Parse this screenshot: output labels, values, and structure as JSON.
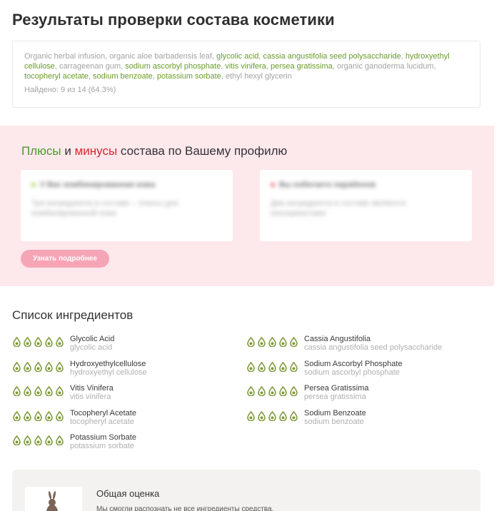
{
  "page": {
    "title": "Результаты проверки состава косметики"
  },
  "composition": {
    "items": [
      {
        "text": "Organic herbal infusion",
        "recognized": false
      },
      {
        "text": "organic aloe barbadensis leaf",
        "recognized": false
      },
      {
        "text": "glycolic acid",
        "recognized": true
      },
      {
        "text": "cassia angustifolia seed polysaccharide",
        "recognized": true
      },
      {
        "text": "hydroxyethyl cellulose",
        "recognized": true
      },
      {
        "text": "carrageenan gum",
        "recognized": false
      },
      {
        "text": "sodium ascorbyl phosphate",
        "recognized": true
      },
      {
        "text": "vitis vinifera",
        "recognized": true
      },
      {
        "text": "persea gratissima",
        "recognized": true
      },
      {
        "text": "organic ganoderma lucidum",
        "recognized": false
      },
      {
        "text": "tocopheryl acetate",
        "recognized": true
      },
      {
        "text": "sodium benzoate",
        "recognized": true
      },
      {
        "text": "potassium sorbate",
        "recognized": true
      },
      {
        "text": "ethyl hexyl glycerin",
        "recognized": false
      }
    ],
    "found_text": "Найдено: 9 из 14 (64.3%)"
  },
  "pros_cons": {
    "title_plus": "Плюсы",
    "title_and": " и ",
    "title_minus": "минусы",
    "title_rest": " состава по Вашему профилю",
    "left_card": {
      "heading": "У Вас комбинированная кожа",
      "body": "Три ингредиента в составе – плюсы для комбинированной кожи"
    },
    "right_card": {
      "heading": "Вы избегаете парабенов",
      "body": "Два ингредиента в составе являются консервантами"
    },
    "more_button": "Узнать подробнее"
  },
  "ingredients": {
    "title": "Список ингредиентов",
    "items": [
      {
        "name": "Glycolic Acid",
        "sub": "glycolic acid",
        "rating": 5
      },
      {
        "name": "Cassia Angustifolia",
        "sub": "cassia angustifolia seed polysaccharide",
        "rating": 5
      },
      {
        "name": "Hydroxyethylcellulose",
        "sub": "hydroxyethyl cellulose",
        "rating": 5
      },
      {
        "name": "Sodium Ascorbyl Phosphate",
        "sub": "sodium ascorbyl phosphate",
        "rating": 5
      },
      {
        "name": "Vitis Vinifera",
        "sub": "vitis vinifera",
        "rating": 5
      },
      {
        "name": "Persea Gratissima",
        "sub": "persea gratissima",
        "rating": 5
      },
      {
        "name": "Tocopheryl Acetate",
        "sub": "tocopheryl acetate",
        "rating": 5
      },
      {
        "name": "Sodium Benzoate",
        "sub": "sodium benzoate",
        "rating": 5
      },
      {
        "name": "Potassium Sorbate",
        "sub": "potassium sorbate",
        "rating": 5
      }
    ]
  },
  "overall": {
    "title": "Общая оценка",
    "text": "Мы смогли распознать не все ингредиенты средства."
  },
  "colors": {
    "recognized": "#6a9c2a",
    "unrecognized": "#a3a3a3",
    "rating_drop": "#7f9a3c",
    "pink_bg": "#fde8ec",
    "button": "#f5a5b6"
  }
}
